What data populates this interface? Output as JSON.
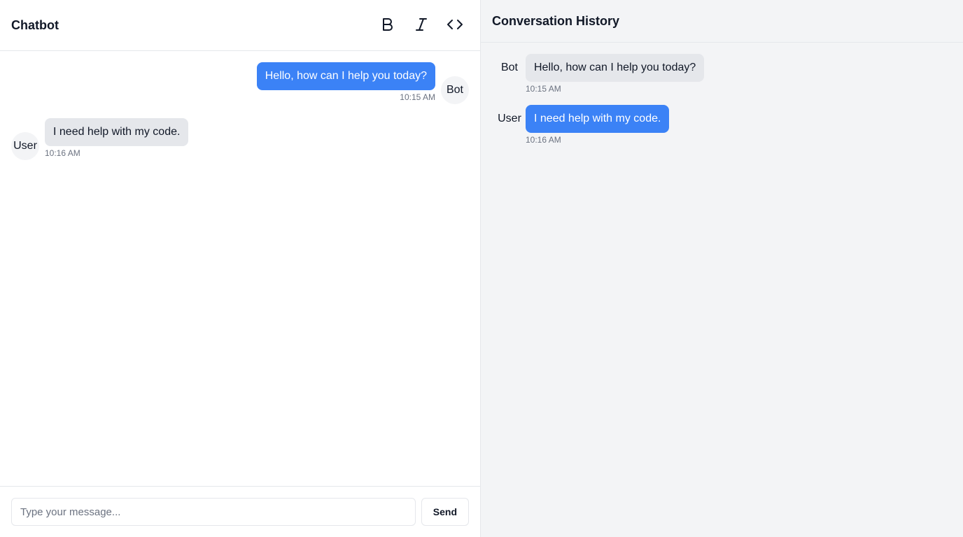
{
  "chat": {
    "title": "Chatbot",
    "toolbar": {
      "bold_icon": "bold-icon",
      "italic_icon": "italic-icon",
      "code_icon": "code-icon"
    },
    "messages": [
      {
        "sender": "Bot",
        "text": "Hello, how can I help you today?",
        "time": "10:15 AM",
        "side": "right",
        "bubble_color": "#3b82f6"
      },
      {
        "sender": "User",
        "text": "I need help with my code.",
        "time": "10:16 AM",
        "side": "left",
        "bubble_color": "#e5e7eb"
      }
    ],
    "composer": {
      "placeholder": "Type your message...",
      "value": "",
      "send_label": "Send"
    }
  },
  "history": {
    "title": "Conversation History",
    "items": [
      {
        "sender": "Bot",
        "text": "Hello, how can I help you today?",
        "time": "10:15 AM",
        "bubble_color": "#e5e7eb"
      },
      {
        "sender": "User",
        "text": "I need help with my code.",
        "time": "10:16 AM",
        "bubble_color": "#3b82f6"
      }
    ]
  },
  "colors": {
    "accent": "#3b82f6",
    "bubble_gray": "#e5e7eb",
    "history_bg": "#f3f4f6",
    "muted_text": "#6b7280"
  }
}
